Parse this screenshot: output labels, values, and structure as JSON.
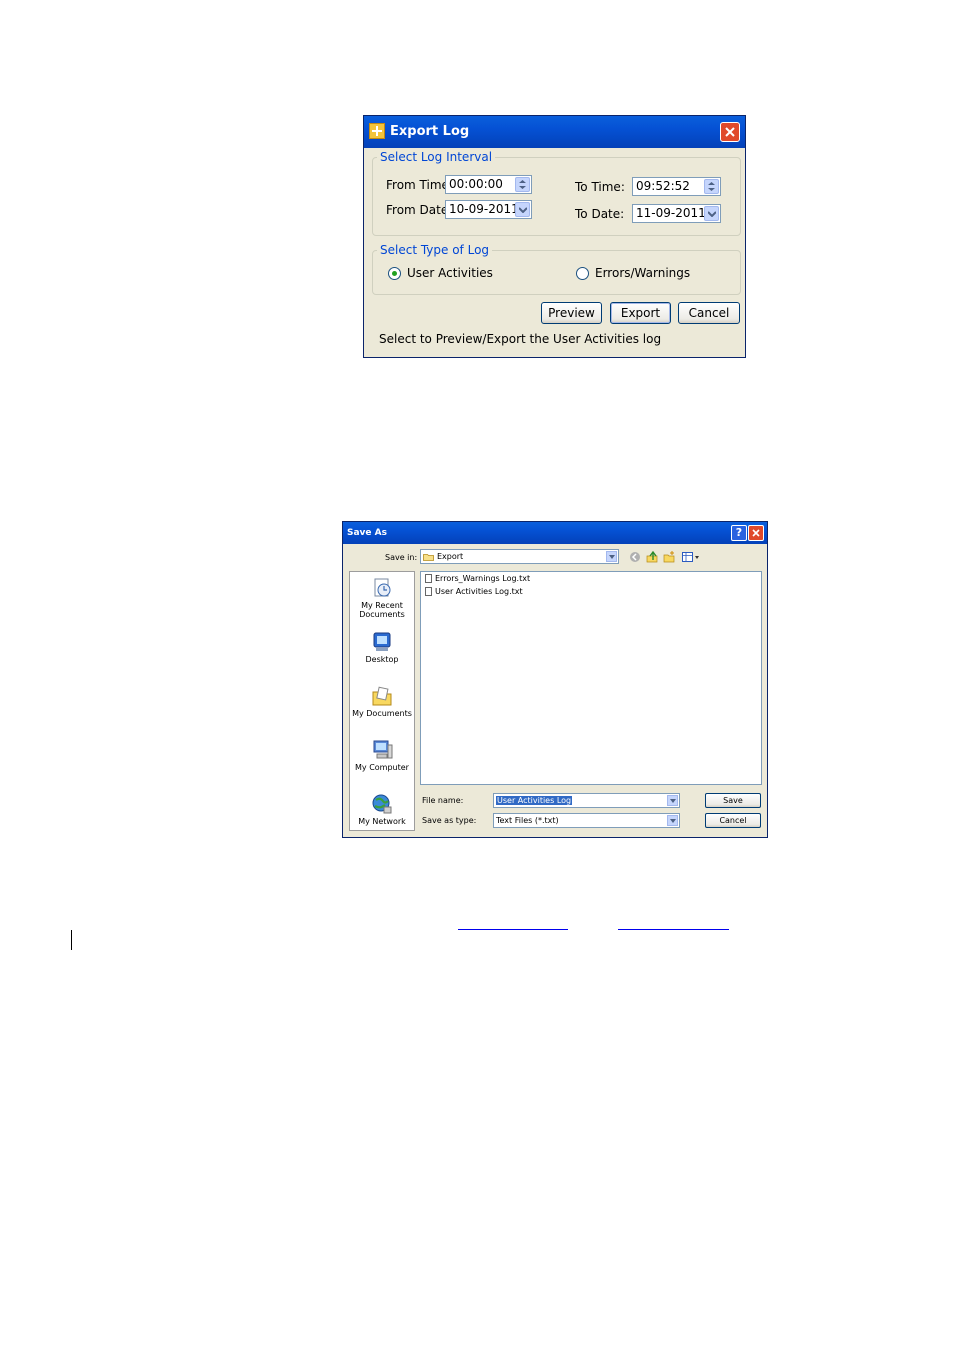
{
  "export_log": {
    "title": "Export Log",
    "interval_group": "Select Log Interval",
    "from_time_label": "From Time:",
    "from_time_value": "00:00:00",
    "from_date_label": "From Date:",
    "from_date_value": "10-09-2011",
    "to_time_label": "To Time:",
    "to_time_value": "09:52:52",
    "to_date_label": "To Date:",
    "to_date_value": "11-09-2011",
    "type_group": "Select Type of Log",
    "option_user": "User Activities",
    "option_errors": "Errors/Warnings",
    "selected_option": "User Activities",
    "preview_button": "Preview",
    "export_button": "Export",
    "cancel_button": "Cancel",
    "status_text": "Select to Preview/Export the User Activities log"
  },
  "save_as": {
    "title": "Save As",
    "save_in_label": "Save in:",
    "save_in_value": "Export",
    "places": [
      "My Recent Documents",
      "Desktop",
      "My Documents",
      "My Computer",
      "My Network"
    ],
    "files": [
      "Errors_Warnings Log.txt",
      "User Activities Log.txt"
    ],
    "file_name_label": "File name:",
    "file_name_value": "User Activities Log",
    "save_type_label": "Save as type:",
    "save_type_value": "Text Files (*.txt)",
    "save_button": "Save",
    "cancel_button": "Cancel"
  },
  "colors": {
    "title_bar": "#0551d4",
    "dialog_bg": "#ece9d8",
    "group_label": "#0046d5",
    "link": "#0000ee"
  }
}
